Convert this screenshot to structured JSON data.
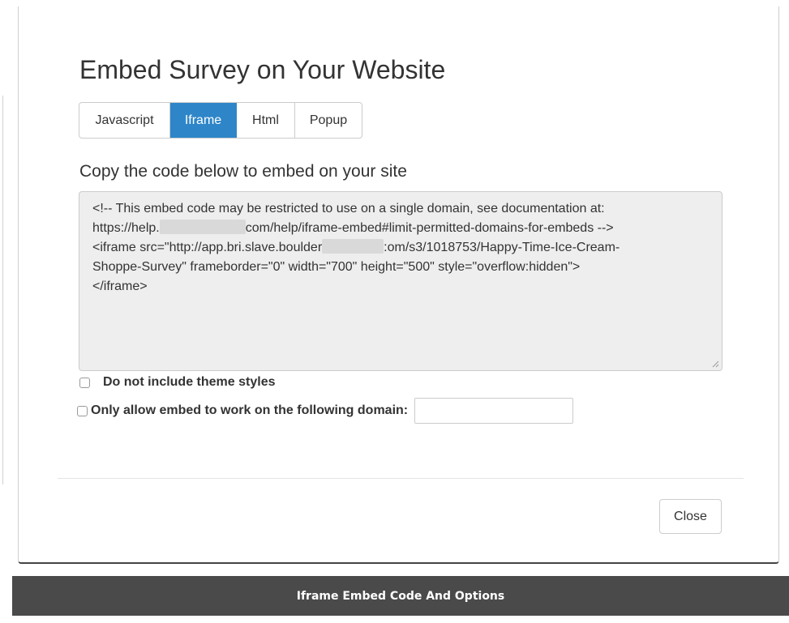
{
  "modal": {
    "title": "Embed Survey on Your Website",
    "tabs": [
      {
        "label": "Javascript",
        "active": false
      },
      {
        "label": "Iframe",
        "active": true
      },
      {
        "label": "Html",
        "active": false
      },
      {
        "label": "Popup",
        "active": false
      }
    ],
    "copy_heading": "Copy the code below to embed on your site",
    "code": {
      "line1": "<!-- This embed code may be restricted to use on a single domain, see documentation at:",
      "line2_pre": "https://help.",
      "line2_post": "com/help/iframe-embed#limit-permitted-domains-for-embeds -->",
      "line3_pre": "<iframe src=\"http://app.bri.slave.boulder",
      "line3_post": ":om/s3/1018753/Happy-Time-Ice-Cream-",
      "line4": "Shoppe-Survey\" frameborder=\"0\" width=\"700\" height=\"500\" style=\"overflow:hidden\">",
      "line5": "</iframe>"
    },
    "options": {
      "theme_label": "Do not include theme styles",
      "theme_checked": false,
      "domain_label": "Only allow embed to work on the following domain:",
      "domain_checked": false,
      "domain_value": ""
    },
    "close_label": "Close"
  },
  "caption": {
    "text": "Iframe Embed Code And Options",
    "background": "#4a4a4a"
  },
  "colors": {
    "accent": "#2e86c9",
    "code_background": "#eeeeee"
  },
  "icons": {
    "resize": "resize-grip-icon"
  }
}
